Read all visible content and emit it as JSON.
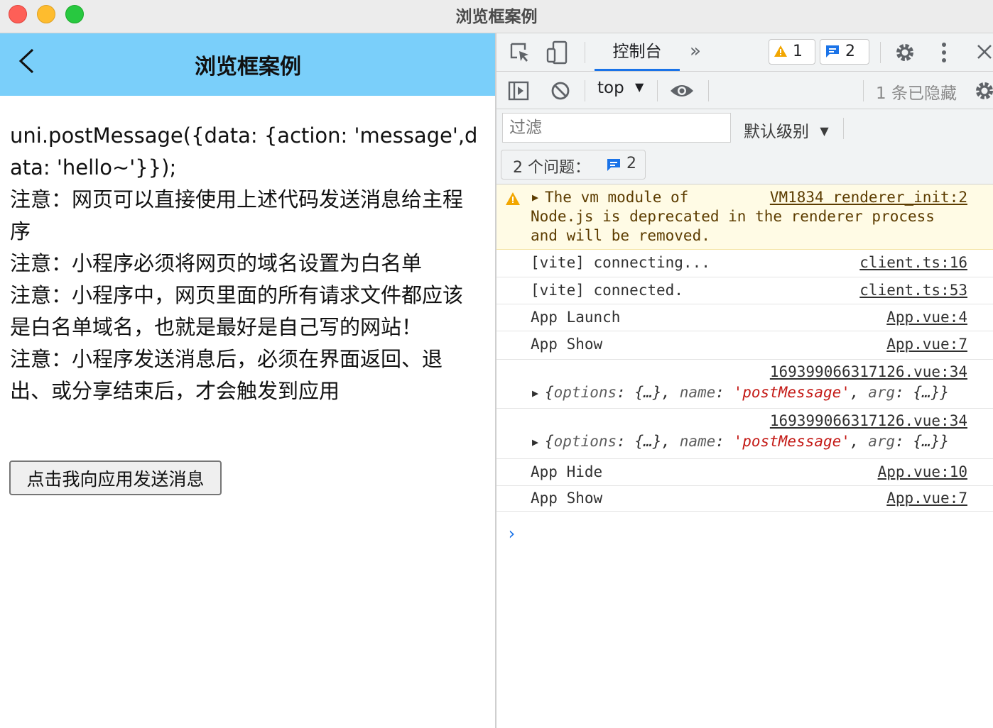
{
  "window": {
    "title": "浏览框案例"
  },
  "app": {
    "nav_title": "浏览框案例",
    "lines": [
      "uni.postMessage({data: {action: 'message',data: 'hello~'}});",
      "注意：网页可以直接使用上述代码发送消息给主程序",
      "注意：小程序必须将网页的域名设置为白名单",
      "注意：小程序中，网页里面的所有请求文件都应该是白名单域名，也就是最好是自己写的网站！",
      "注意：小程序发送消息后，必须在界面返回、退出、或分享结束后，才会触发到应用"
    ],
    "send_button": "点击我向应用发送消息",
    "nav_color": "#7acffa"
  },
  "devtools": {
    "tabs": {
      "console": "控制台",
      "more": "»"
    },
    "warnings_count": "1",
    "messages_count": "2",
    "context": "top",
    "hidden_text": "1 条已隐藏",
    "filter_placeholder": "过滤",
    "level": "默认级别",
    "issues_label": "2 个问题：",
    "issues_count": "2",
    "logs": {
      "warn": {
        "msg_line1": "The vm module of",
        "msg_line2": "Node.js is deprecated in the renderer process",
        "msg_line3": "and will be removed.",
        "src": "VM1834 renderer_init:2"
      },
      "vite1": {
        "msg": "[vite] connecting...",
        "src": "client.ts:16"
      },
      "vite2": {
        "msg": "[vite] connected.",
        "src": "client.ts:53"
      },
      "launch": {
        "msg": "App Launch",
        "src": "App.vue:4"
      },
      "show1": {
        "msg": "App Show",
        "src": "App.vue:7"
      },
      "obj1": {
        "src": "169399066317126.vue:34",
        "k1": "options",
        "v1": "{…}",
        "k2": "name",
        "v2": "'postMessage'",
        "k3": "arg",
        "v3": "{…}"
      },
      "obj2": {
        "src": "169399066317126.vue:34",
        "k1": "options",
        "v1": "{…}",
        "k2": "name",
        "v2": "'postMessage'",
        "k3": "arg",
        "v3": "{…}"
      },
      "hide": {
        "msg": "App Hide",
        "src": "App.vue:10"
      },
      "show2": {
        "msg": "App Show",
        "src": "App.vue:7"
      }
    },
    "prompt": "›",
    "accent_color": "#1a73e8"
  }
}
